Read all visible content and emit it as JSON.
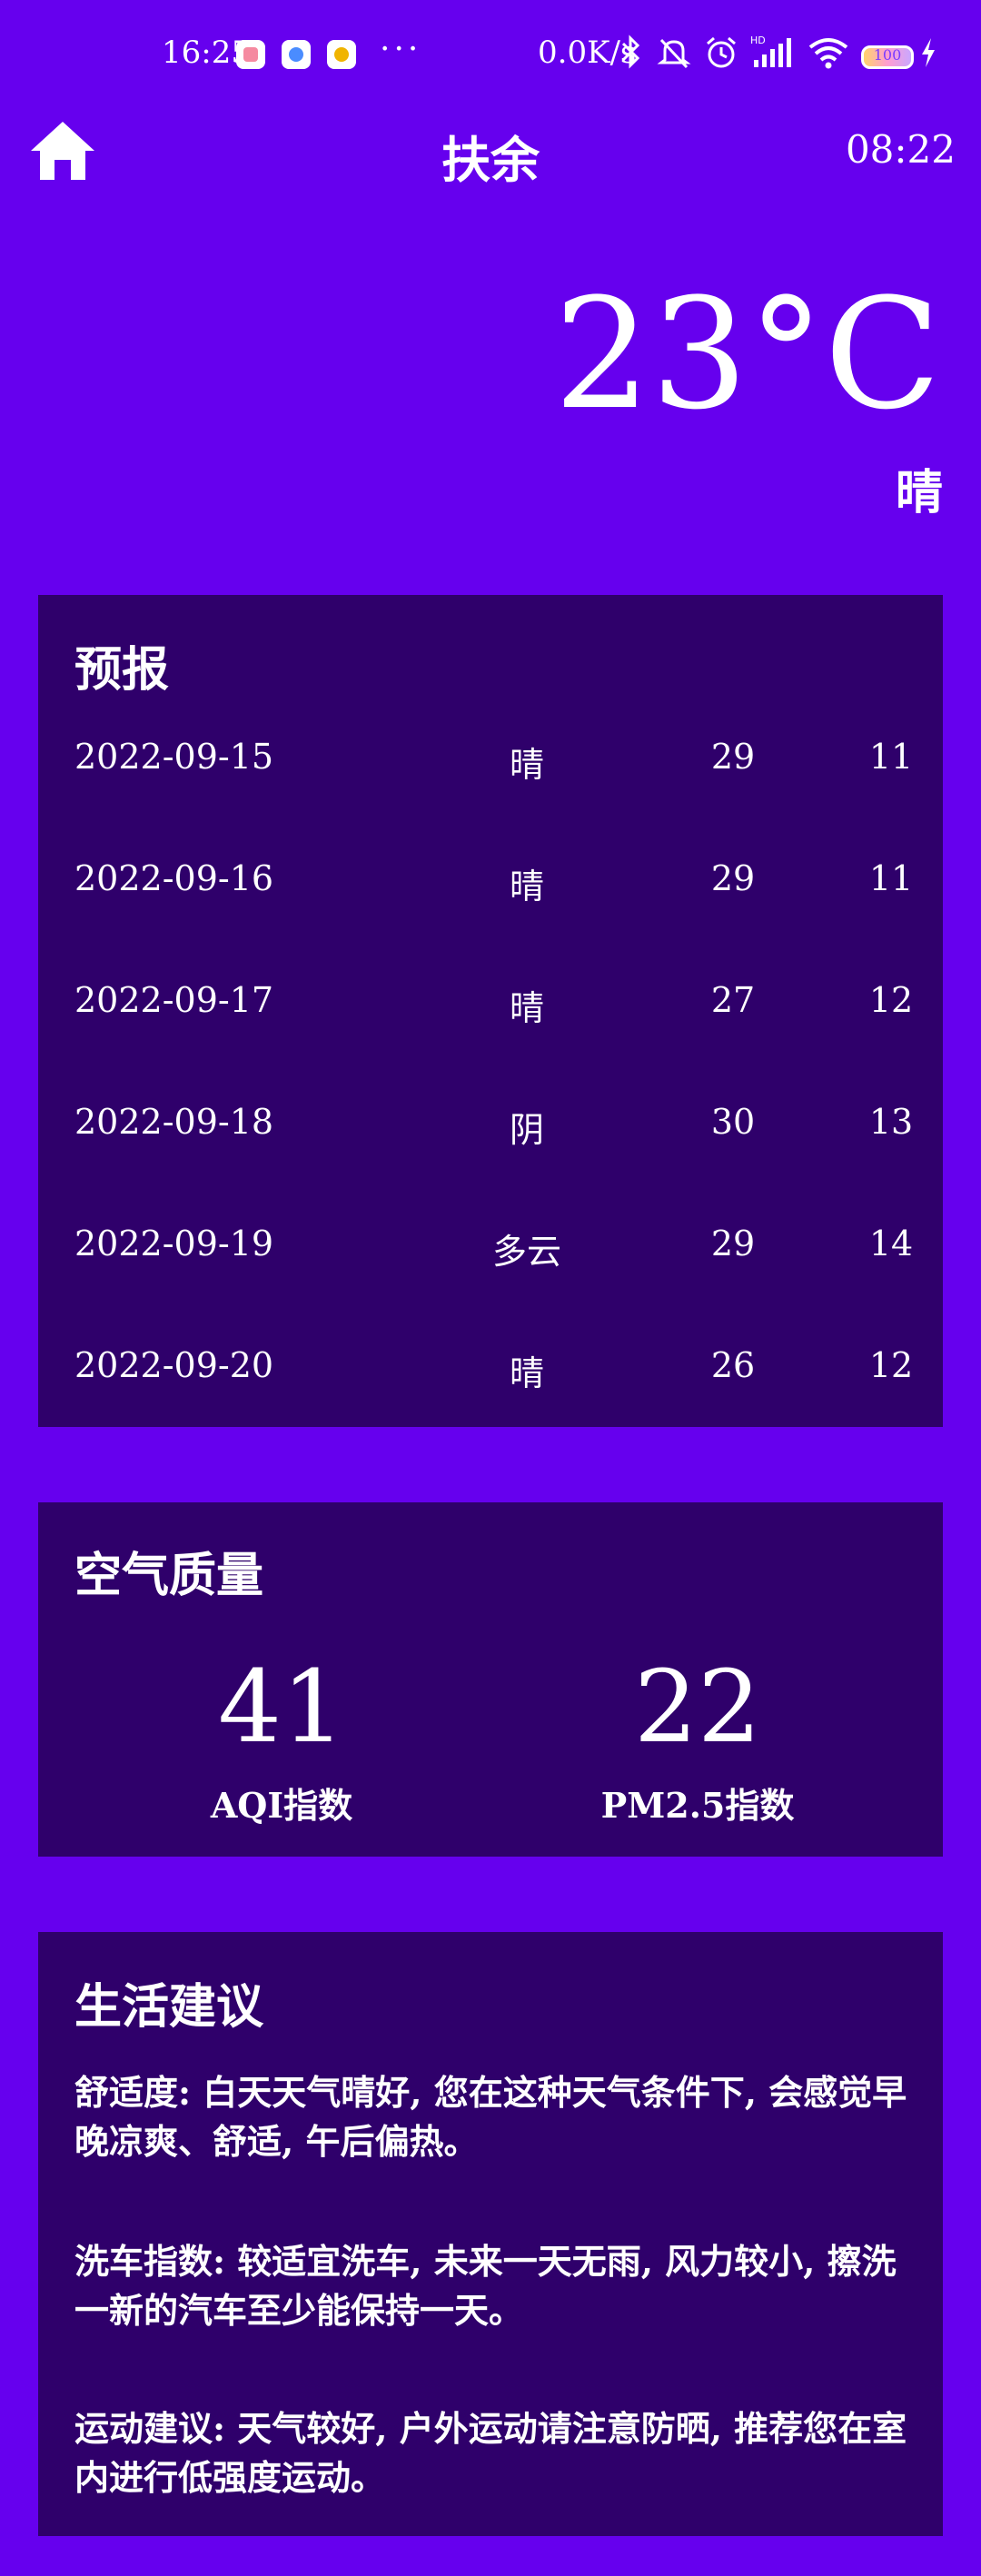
{
  "status_bar": {
    "time": "16:25",
    "more": "···",
    "net_speed": "0.0K/s",
    "battery": "100"
  },
  "header": {
    "city": "扶余",
    "update_time": "08:22"
  },
  "current": {
    "temperature": "23°C",
    "weather": "晴"
  },
  "forecast": {
    "title": "预报",
    "rows": [
      {
        "date": "2022-09-15",
        "condition": "晴",
        "high": "29",
        "low": "11"
      },
      {
        "date": "2022-09-16",
        "condition": "晴",
        "high": "29",
        "low": "11"
      },
      {
        "date": "2022-09-17",
        "condition": "晴",
        "high": "27",
        "low": "12"
      },
      {
        "date": "2022-09-18",
        "condition": "阴",
        "high": "30",
        "low": "13"
      },
      {
        "date": "2022-09-19",
        "condition": "多云",
        "high": "29",
        "low": "14"
      },
      {
        "date": "2022-09-20",
        "condition": "晴",
        "high": "26",
        "low": "12"
      }
    ]
  },
  "air_quality": {
    "title": "空气质量",
    "aqi_value": "41",
    "aqi_label": "AQI指数",
    "pm25_value": "22",
    "pm25_label": "PM2.5指数"
  },
  "life_advice": {
    "title": "生活建议",
    "comfort": "舒适度: 白天天气晴好, 您在这种天气条件下, 会感觉早晚凉爽、舒适, 午后偏热。",
    "car_wash": "洗车指数: 较适宜洗车, 未来一天无雨, 风力较小, 擦洗一新的汽车至少能保持一天。",
    "sport": "运动建议: 天气较好, 户外运动请注意防晒, 推荐您在室内进行低强度运动。"
  },
  "colors": {
    "background": "#6600EE",
    "card": "#2F006B",
    "text": "#FFFFFF"
  }
}
